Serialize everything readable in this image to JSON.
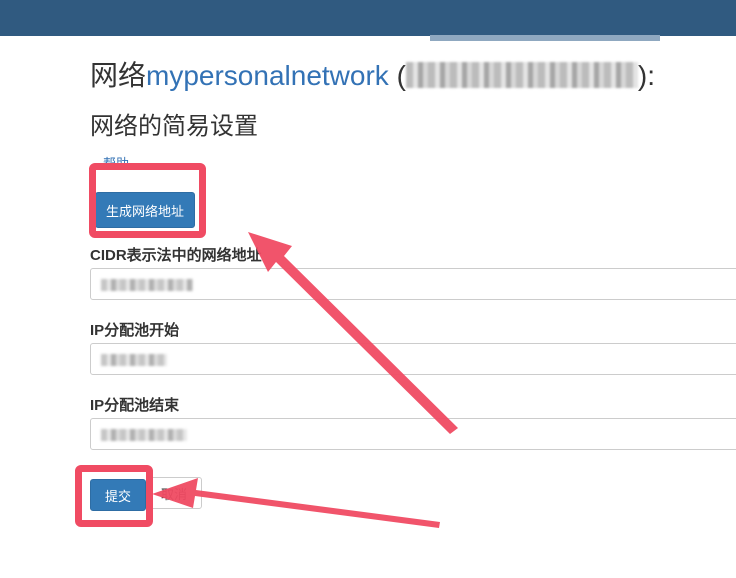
{
  "header": {
    "bar_color": "#305a80"
  },
  "title": {
    "prefix": "网络",
    "network_name": "mypersonalnetwork",
    "open_paren": " (",
    "close_paren": "):"
  },
  "subtitle": "网络的简易设置",
  "help_link": "帮助",
  "generate_button": "生成网络地址",
  "fields": {
    "cidr_label": "CIDR表示法中的网络地址",
    "pool_start_label": "IP分配池开始",
    "pool_end_label": "IP分配池结束"
  },
  "actions": {
    "submit_label": "提交",
    "cancel_label": "取消"
  },
  "annotation": {
    "highlight_color": "#f04b63"
  }
}
